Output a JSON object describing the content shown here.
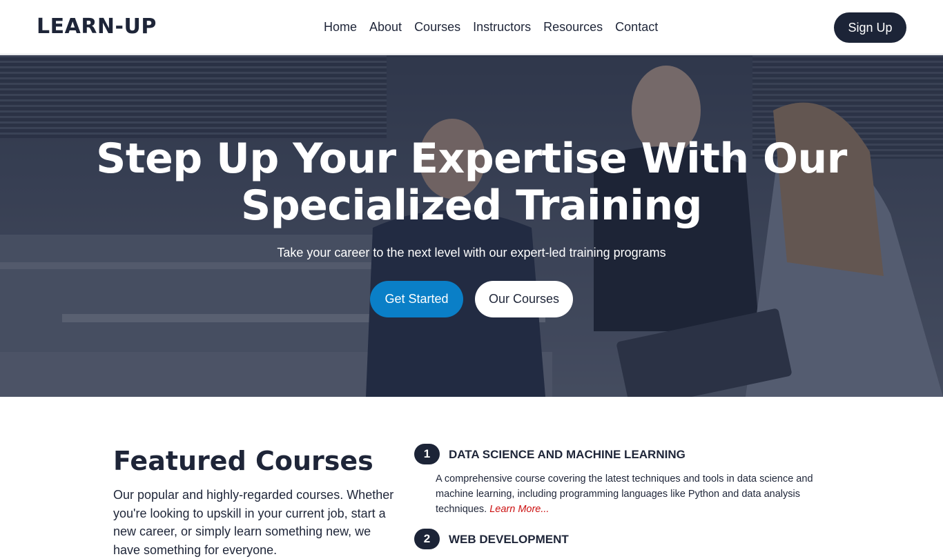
{
  "nav": {
    "logo": "LEARN-UP",
    "links": [
      "Home",
      "About",
      "Courses",
      "Instructors",
      "Resources",
      "Contact"
    ],
    "signup": "Sign Up"
  },
  "hero": {
    "title": "Step Up Your Expertise With Our Specialized Training",
    "subtitle": "Take your career to the next level with our expert-led training programs",
    "primary_button": "Get Started",
    "secondary_button": "Our Courses"
  },
  "featured": {
    "title": "Featured Courses",
    "description": "Our popular and highly-regarded courses. Whether you're looking to upskill in your current job, start a new career, or simply learn something new, we have something for everyone."
  },
  "courses": [
    {
      "number": "1",
      "title": "DATA SCIENCE AND MACHINE LEARNING",
      "description": "A comprehensive course covering the latest techniques and tools in data science and machine learning, including programming languages like Python and data analysis techniques.",
      "link": "Learn More..."
    },
    {
      "number": "2",
      "title": "WEB DEVELOPMENT",
      "description": "",
      "link": ""
    }
  ],
  "colors": {
    "brand_dark": "#1c2437",
    "primary_blue": "#0a7fc7",
    "link_red": "#cc1111",
    "accent_orange": "#e58b00"
  }
}
